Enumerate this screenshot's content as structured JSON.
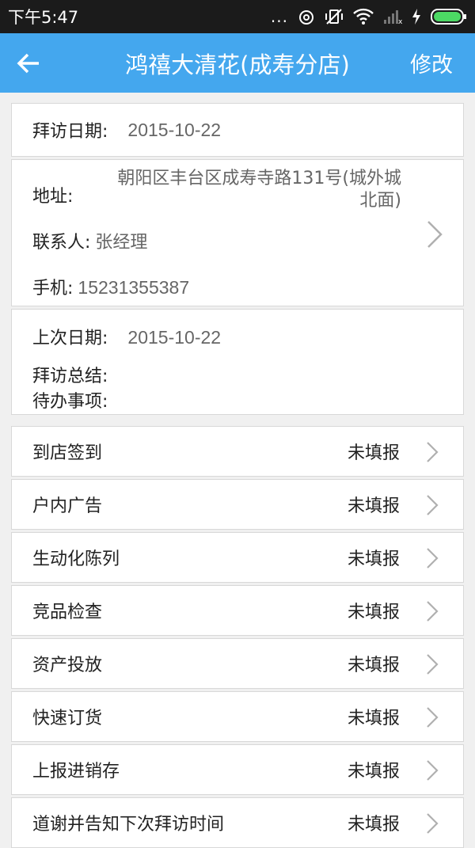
{
  "status_bar": {
    "time": "下午5:47",
    "dots": "...",
    "icons": [
      "alarm-icon",
      "mute-vibrate-icon",
      "wifi-icon",
      "signal-icon",
      "charging-icon",
      "battery-icon"
    ],
    "battery_color": "#4cd964"
  },
  "app_bar": {
    "title": "鸿禧大清花(成寿分店)",
    "edit_label": "修改",
    "back_icon": "arrow-left-icon",
    "color": "#44a7ee"
  },
  "visit": {
    "date_label": "拜访日期:",
    "date_value": "2015-10-22"
  },
  "contact": {
    "address_label": "地址:",
    "address_line1": "朝阳区丰台区成寿寺路131号(城外城",
    "address_line2": "北面)",
    "contact_label": "联系人:",
    "contact_value": "张经理",
    "phone_label": "手机:",
    "phone_value": "15231355387"
  },
  "last_visit": {
    "date_label": "上次日期:",
    "date_value": "2015-10-22",
    "summary_label": "拜访总结:",
    "todo_label": "待办事项:"
  },
  "tasks": [
    {
      "label": "到店签到",
      "status": "未填报"
    },
    {
      "label": "户内广告",
      "status": "未填报"
    },
    {
      "label": "生动化陈列",
      "status": "未填报"
    },
    {
      "label": "竞品检查",
      "status": "未填报"
    },
    {
      "label": "资产投放",
      "status": "未填报"
    },
    {
      "label": "快速订货",
      "status": "未填报"
    },
    {
      "label": "上报进销存",
      "status": "未填报"
    },
    {
      "label": "道谢并告知下次拜访时间",
      "status": "未填报"
    }
  ]
}
